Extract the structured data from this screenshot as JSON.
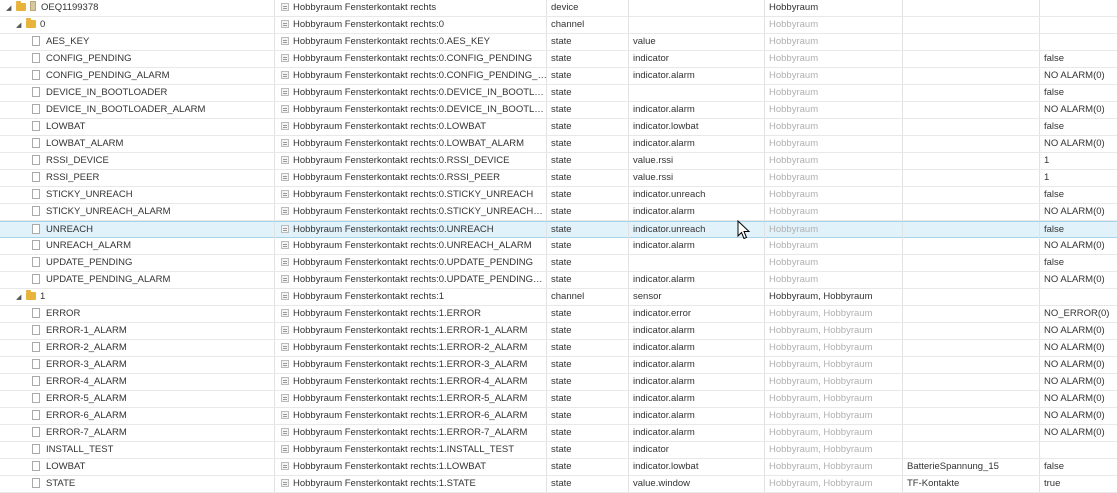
{
  "rows": [
    {
      "level": 0,
      "kind": "device",
      "expanded": true,
      "label": "OEQ1199378",
      "name": "Hobbyraum Fensterkontakt rechts",
      "type": "device",
      "role": "",
      "room": "Hobbyraum",
      "room_dark": true,
      "function": "",
      "value": ""
    },
    {
      "level": 1,
      "kind": "folder",
      "expanded": true,
      "label": "0",
      "name": "Hobbyraum Fensterkontakt rechts:0",
      "type": "channel",
      "role": "",
      "room": "Hobbyraum",
      "room_dark": false,
      "function": "",
      "value": ""
    },
    {
      "level": 2,
      "kind": "state",
      "label": "AES_KEY",
      "name": "Hobbyraum Fensterkontakt rechts:0.AES_KEY",
      "type": "state",
      "role": "value",
      "room": "Hobbyraum",
      "room_dark": false,
      "function": "",
      "value": ""
    },
    {
      "level": 2,
      "kind": "state",
      "label": "CONFIG_PENDING",
      "name": "Hobbyraum Fensterkontakt rechts:0.CONFIG_PENDING",
      "type": "state",
      "role": "indicator",
      "room": "Hobbyraum",
      "room_dark": false,
      "function": "",
      "value": "false"
    },
    {
      "level": 2,
      "kind": "state",
      "label": "CONFIG_PENDING_ALARM",
      "name": "Hobbyraum Fensterkontakt rechts:0.CONFIG_PENDING_ALA...",
      "type": "state",
      "role": "indicator.alarm",
      "room": "Hobbyraum",
      "room_dark": false,
      "function": "",
      "value": "NO ALARM(0)"
    },
    {
      "level": 2,
      "kind": "state",
      "label": "DEVICE_IN_BOOTLOADER",
      "name": "Hobbyraum Fensterkontakt rechts:0.DEVICE_IN_BOOTLOADER",
      "type": "state",
      "role": "",
      "room": "Hobbyraum",
      "room_dark": false,
      "function": "",
      "value": "false"
    },
    {
      "level": 2,
      "kind": "state",
      "label": "DEVICE_IN_BOOTLOADER_ALARM",
      "name": "Hobbyraum Fensterkontakt rechts:0.DEVICE_IN_BOOTLOAD...",
      "type": "state",
      "role": "indicator.alarm",
      "room": "Hobbyraum",
      "room_dark": false,
      "function": "",
      "value": "NO ALARM(0)"
    },
    {
      "level": 2,
      "kind": "state",
      "label": "LOWBAT",
      "name": "Hobbyraum Fensterkontakt rechts:0.LOWBAT",
      "type": "state",
      "role": "indicator.lowbat",
      "room": "Hobbyraum",
      "room_dark": false,
      "function": "",
      "value": "false"
    },
    {
      "level": 2,
      "kind": "state",
      "label": "LOWBAT_ALARM",
      "name": "Hobbyraum Fensterkontakt rechts:0.LOWBAT_ALARM",
      "type": "state",
      "role": "indicator.alarm",
      "room": "Hobbyraum",
      "room_dark": false,
      "function": "",
      "value": "NO ALARM(0)"
    },
    {
      "level": 2,
      "kind": "state",
      "label": "RSSI_DEVICE",
      "name": "Hobbyraum Fensterkontakt rechts:0.RSSI_DEVICE",
      "type": "state",
      "role": "value.rssi",
      "room": "Hobbyraum",
      "room_dark": false,
      "function": "",
      "value": "1"
    },
    {
      "level": 2,
      "kind": "state",
      "label": "RSSI_PEER",
      "name": "Hobbyraum Fensterkontakt rechts:0.RSSI_PEER",
      "type": "state",
      "role": "value.rssi",
      "room": "Hobbyraum",
      "room_dark": false,
      "function": "",
      "value": "1"
    },
    {
      "level": 2,
      "kind": "state",
      "label": "STICKY_UNREACH",
      "name": "Hobbyraum Fensterkontakt rechts:0.STICKY_UNREACH",
      "type": "state",
      "role": "indicator.unreach",
      "room": "Hobbyraum",
      "room_dark": false,
      "function": "",
      "value": "false"
    },
    {
      "level": 2,
      "kind": "state",
      "label": "STICKY_UNREACH_ALARM",
      "name": "Hobbyraum Fensterkontakt rechts:0.STICKY_UNREACH_ALA...",
      "type": "state",
      "role": "indicator.alarm",
      "room": "Hobbyraum",
      "room_dark": false,
      "function": "",
      "value": "NO ALARM(0)"
    },
    {
      "level": 2,
      "kind": "state",
      "label": "UNREACH",
      "name": "Hobbyraum Fensterkontakt rechts:0.UNREACH",
      "type": "state",
      "role": "indicator.unreach",
      "room": "Hobbyraum",
      "room_dark": false,
      "function": "",
      "value": "false",
      "selected": true
    },
    {
      "level": 2,
      "kind": "state",
      "label": "UNREACH_ALARM",
      "name": "Hobbyraum Fensterkontakt rechts:0.UNREACH_ALARM",
      "type": "state",
      "role": "indicator.alarm",
      "room": "Hobbyraum",
      "room_dark": false,
      "function": "",
      "value": "NO ALARM(0)"
    },
    {
      "level": 2,
      "kind": "state",
      "label": "UPDATE_PENDING",
      "name": "Hobbyraum Fensterkontakt rechts:0.UPDATE_PENDING",
      "type": "state",
      "role": "",
      "room": "Hobbyraum",
      "room_dark": false,
      "function": "",
      "value": "false"
    },
    {
      "level": 2,
      "kind": "state",
      "label": "UPDATE_PENDING_ALARM",
      "name": "Hobbyraum Fensterkontakt rechts:0.UPDATE_PENDING_ALA...",
      "type": "state",
      "role": "indicator.alarm",
      "room": "Hobbyraum",
      "room_dark": false,
      "function": "",
      "value": "NO ALARM(0)"
    },
    {
      "level": 1,
      "kind": "folder",
      "expanded": true,
      "label": "1",
      "name": "Hobbyraum Fensterkontakt rechts:1",
      "type": "channel",
      "role": "sensor",
      "room": "Hobbyraum, Hobbyraum",
      "room_dark": true,
      "function": "",
      "value": ""
    },
    {
      "level": 2,
      "kind": "state",
      "label": "ERROR",
      "name": "Hobbyraum Fensterkontakt rechts:1.ERROR",
      "type": "state",
      "role": "indicator.error",
      "room": "Hobbyraum, Hobbyraum",
      "room_dark": false,
      "function": "",
      "value": "NO_ERROR(0)"
    },
    {
      "level": 2,
      "kind": "state",
      "label": "ERROR-1_ALARM",
      "name": "Hobbyraum Fensterkontakt rechts:1.ERROR-1_ALARM",
      "type": "state",
      "role": "indicator.alarm",
      "room": "Hobbyraum, Hobbyraum",
      "room_dark": false,
      "function": "",
      "value": "NO ALARM(0)"
    },
    {
      "level": 2,
      "kind": "state",
      "label": "ERROR-2_ALARM",
      "name": "Hobbyraum Fensterkontakt rechts:1.ERROR-2_ALARM",
      "type": "state",
      "role": "indicator.alarm",
      "room": "Hobbyraum, Hobbyraum",
      "room_dark": false,
      "function": "",
      "value": "NO ALARM(0)"
    },
    {
      "level": 2,
      "kind": "state",
      "label": "ERROR-3_ALARM",
      "name": "Hobbyraum Fensterkontakt rechts:1.ERROR-3_ALARM",
      "type": "state",
      "role": "indicator.alarm",
      "room": "Hobbyraum, Hobbyraum",
      "room_dark": false,
      "function": "",
      "value": "NO ALARM(0)"
    },
    {
      "level": 2,
      "kind": "state",
      "label": "ERROR-4_ALARM",
      "name": "Hobbyraum Fensterkontakt rechts:1.ERROR-4_ALARM",
      "type": "state",
      "role": "indicator.alarm",
      "room": "Hobbyraum, Hobbyraum",
      "room_dark": false,
      "function": "",
      "value": "NO ALARM(0)"
    },
    {
      "level": 2,
      "kind": "state",
      "label": "ERROR-5_ALARM",
      "name": "Hobbyraum Fensterkontakt rechts:1.ERROR-5_ALARM",
      "type": "state",
      "role": "indicator.alarm",
      "room": "Hobbyraum, Hobbyraum",
      "room_dark": false,
      "function": "",
      "value": "NO ALARM(0)"
    },
    {
      "level": 2,
      "kind": "state",
      "label": "ERROR-6_ALARM",
      "name": "Hobbyraum Fensterkontakt rechts:1.ERROR-6_ALARM",
      "type": "state",
      "role": "indicator.alarm",
      "room": "Hobbyraum, Hobbyraum",
      "room_dark": false,
      "function": "",
      "value": "NO ALARM(0)"
    },
    {
      "level": 2,
      "kind": "state",
      "label": "ERROR-7_ALARM",
      "name": "Hobbyraum Fensterkontakt rechts:1.ERROR-7_ALARM",
      "type": "state",
      "role": "indicator.alarm",
      "room": "Hobbyraum, Hobbyraum",
      "room_dark": false,
      "function": "",
      "value": "NO ALARM(0)"
    },
    {
      "level": 2,
      "kind": "state",
      "label": "INSTALL_TEST",
      "name": "Hobbyraum Fensterkontakt rechts:1.INSTALL_TEST",
      "type": "state",
      "role": "indicator",
      "room": "Hobbyraum, Hobbyraum",
      "room_dark": false,
      "function": "",
      "value": ""
    },
    {
      "level": 2,
      "kind": "state",
      "label": "LOWBAT",
      "name": "Hobbyraum Fensterkontakt rechts:1.LOWBAT",
      "type": "state",
      "role": "indicator.lowbat",
      "room": "Hobbyraum, Hobbyraum",
      "room_dark": false,
      "function": "BatterieSpannung_15",
      "value": "false"
    },
    {
      "level": 2,
      "kind": "state",
      "label": "STATE",
      "name": "Hobbyraum Fensterkontakt rechts:1.STATE",
      "type": "state",
      "role": "value.window",
      "room": "Hobbyraum, Hobbyraum",
      "room_dark": false,
      "function": "TF-Kontakte",
      "value": "true"
    }
  ]
}
